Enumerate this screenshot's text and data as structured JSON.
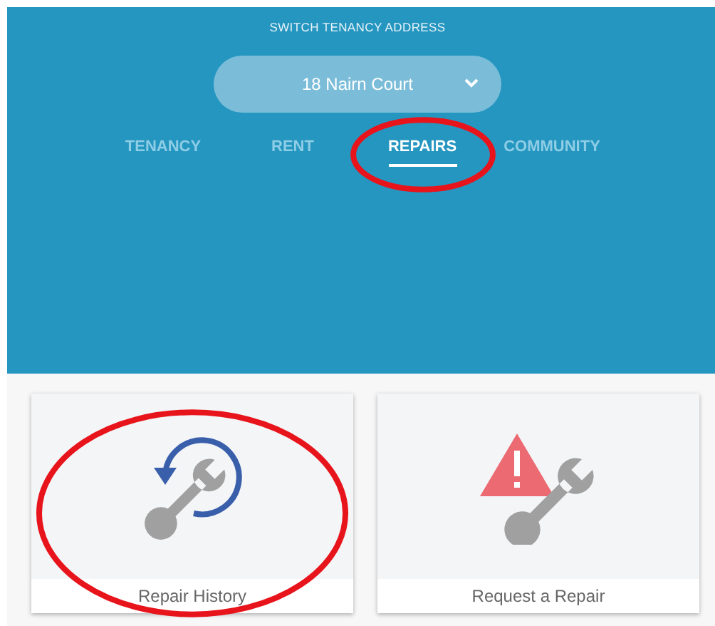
{
  "header": {
    "title": "SWITCH TENANCY ADDRESS",
    "address_select": {
      "value": "18 Nairn Court"
    }
  },
  "tabs": [
    {
      "label": "TENANCY",
      "selected": false,
      "highlighted": false
    },
    {
      "label": "RENT",
      "selected": false,
      "highlighted": false
    },
    {
      "label": "REPAIRS",
      "selected": true,
      "highlighted": true
    },
    {
      "label": "COMMUNITY",
      "selected": false,
      "highlighted": false
    }
  ],
  "cards": [
    {
      "kind": "history",
      "label": "Repair History",
      "highlighted": true
    },
    {
      "kind": "request",
      "label": "Request a Repair",
      "highlighted": false
    }
  ]
}
